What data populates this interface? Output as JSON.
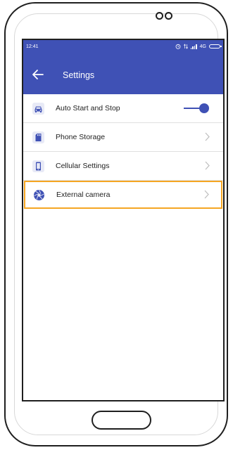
{
  "status_bar": {
    "time": "12:41",
    "network": "4G"
  },
  "app_bar": {
    "title": "Settings"
  },
  "settings": {
    "items": [
      {
        "label": "Auto Start and Stop",
        "icon": "car-icon",
        "control": "toggle",
        "toggle_on": true
      },
      {
        "label": "Phone Storage",
        "icon": "sd-card-icon",
        "control": "chevron"
      },
      {
        "label": "Cellular Settings",
        "icon": "smartphone-icon",
        "control": "chevron"
      },
      {
        "label": "External camera",
        "icon": "camera-aperture-icon",
        "control": "chevron",
        "highlighted": true
      }
    ]
  },
  "colors": {
    "primary": "#3f51b5",
    "highlight_border": "#f5a623",
    "device_outline": "#1f1f1f"
  }
}
